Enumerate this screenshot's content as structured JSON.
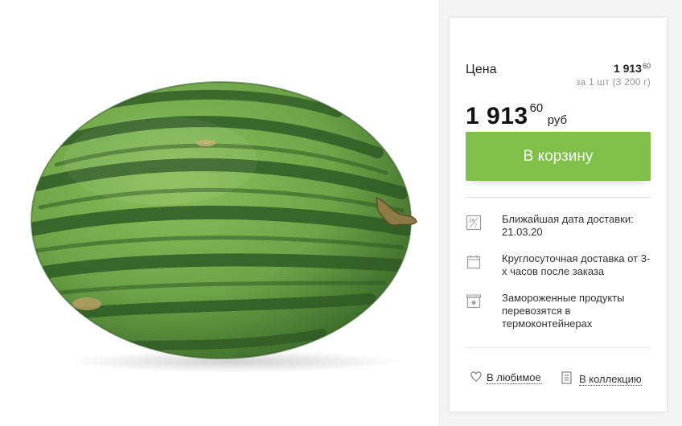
{
  "product_image": {
    "alt_name": "watermelon"
  },
  "price": {
    "heading": "Цена",
    "unit_price_int": "1 913",
    "unit_price_kop": "60",
    "unit_note": "за 1 шт (3 200 г)",
    "price_int": "1 913",
    "price_kop": "60",
    "currency": "руб"
  },
  "cart_button_label": "В корзину",
  "info": [
    {
      "icon": "calendar-24-7-icon",
      "text": "Ближайшая дата доставки: 21.03.20"
    },
    {
      "icon": "clock-calendar-icon",
      "text": "Круглосуточная доставка от 3-х часов после заказа"
    },
    {
      "icon": "freezer-box-icon",
      "text": "Замороженные продукты перевозятся в термоконтейнерах"
    }
  ],
  "actions": {
    "favorite_label": "В любимое",
    "collection_label": "В коллекцию"
  },
  "colors": {
    "accent_green": "#7ec04a",
    "muted_text": "#9a9a9a",
    "divider": "#e4e4e4"
  }
}
